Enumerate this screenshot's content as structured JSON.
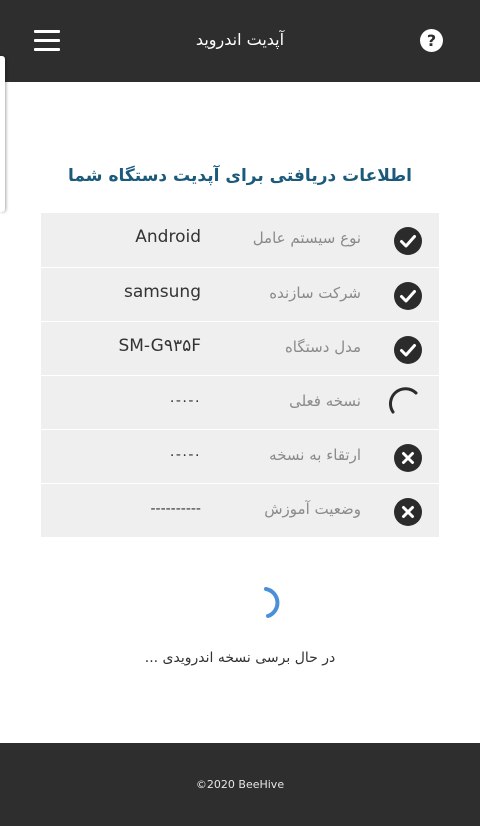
{
  "header": {
    "title": "آپدیت اندروید",
    "menu_icon": "hamburger-menu-icon",
    "help_icon": "question-mark-circle-icon",
    "help_symbol": "?"
  },
  "main": {
    "heading": "اطلاعات دریافتی برای آپدیت دستگاه شما",
    "rows": [
      {
        "label": "نوع سیستم عامل",
        "value": "Android",
        "status": "check"
      },
      {
        "label": "شرکت سازنده",
        "value": "samsung",
        "status": "check"
      },
      {
        "label": "مدل دستگاه",
        "value": "SM-G۹۳۵F",
        "status": "check"
      },
      {
        "label": "نسخه فعلی",
        "value": "۰-۰-۰",
        "status": "loading"
      },
      {
        "label": "ارتقاء به نسخه",
        "value": "۰-۰-۰",
        "status": "error"
      },
      {
        "label": "وضعیت آموزش",
        "value": "----------",
        "status": "error"
      }
    ],
    "loading_text": "در حال برسی نسخه اندرویدی ..."
  },
  "footer": {
    "copyright": "©2020 BeeHive"
  },
  "colors": {
    "bar_bg": "#2e2e2e",
    "heading": "#1b5a7a",
    "table_bg": "#efefef",
    "loader": "#4a90d9"
  }
}
